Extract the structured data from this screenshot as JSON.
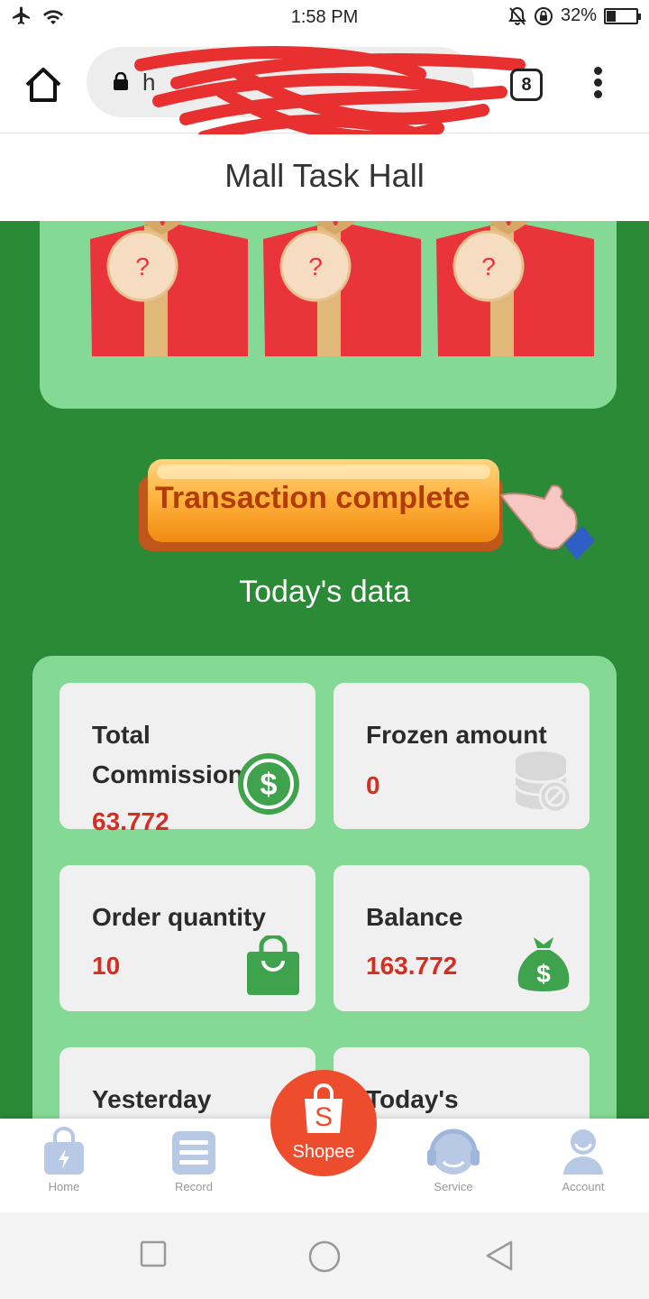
{
  "status_bar": {
    "time": "1:58 PM",
    "battery": "32%",
    "battery_level": 0.32
  },
  "browser": {
    "url_partial": "h",
    "tab_count": "8",
    "icons": [
      "home-icon",
      "lock-icon",
      "menu-icon"
    ]
  },
  "page": {
    "title": "Mall Task Hall"
  },
  "gifts": [
    "?",
    "?",
    "?"
  ],
  "action": {
    "label": "Transaction complete"
  },
  "section": {
    "title": "Today's data"
  },
  "stats": {
    "total_commission": {
      "label": "Total Commission",
      "value": "63.772"
    },
    "frozen_amount": {
      "label": "Frozen amount",
      "value": "0"
    },
    "order_quantity": {
      "label": "Order quantity",
      "value": "10"
    },
    "balance": {
      "label": "Balance",
      "value": "163.772"
    },
    "yesterday": {
      "label": "Yesterday"
    },
    "todays": {
      "label": "Today's"
    }
  },
  "nav": {
    "home": "Home",
    "record": "Record",
    "shopee": "Shopee",
    "service": "Service",
    "account": "Account"
  },
  "colors": {
    "main_green": "#2a8a36",
    "card_green": "#84da94",
    "value_red": "#d62d20",
    "shopee_orange": "#ee4d2d"
  }
}
